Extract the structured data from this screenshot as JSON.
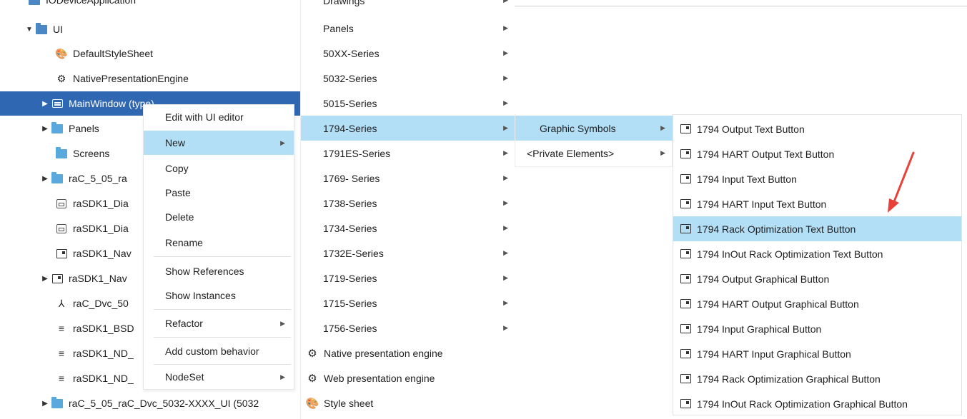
{
  "tree": {
    "partial_top": "IODeviceApplication",
    "items": [
      {
        "label": "UI",
        "arrow": "▼",
        "icon": "folder-dark-icon"
      },
      {
        "label": "DefaultStyleSheet",
        "arrow": "",
        "icon": "stylesheet-icon"
      },
      {
        "label": "NativePresentationEngine",
        "arrow": "",
        "icon": "gear-icon"
      },
      {
        "label": "MainWindow (type)",
        "arrow": "▶",
        "icon": "window-icon"
      },
      {
        "label": "Panels",
        "arrow": "▶",
        "icon": "folder-icon"
      },
      {
        "label": "Screens",
        "arrow": "",
        "icon": "folder-icon"
      },
      {
        "label": "raC_5_05_ra",
        "arrow": "▶",
        "icon": "folder-icon"
      },
      {
        "label": "raSDK1_Dia",
        "arrow": "",
        "icon": "dialog-icon"
      },
      {
        "label": "raSDK1_Dia",
        "arrow": "",
        "icon": "dialog-icon"
      },
      {
        "label": "raSDK1_Nav",
        "arrow": "",
        "icon": "button-icon"
      },
      {
        "label": "raSDK1_Nav",
        "arrow": "▶",
        "icon": "nav-button-icon"
      },
      {
        "label": "raC_Dvc_50",
        "arrow": "",
        "icon": "network-icon"
      },
      {
        "label": "raSDK1_BSD",
        "arrow": "",
        "icon": "struct-icon"
      },
      {
        "label": "raSDK1_ND_",
        "arrow": "",
        "icon": "struct-icon"
      },
      {
        "label": "raSDK1_ND_",
        "arrow": "",
        "icon": "struct-icon"
      },
      {
        "label": "raC_5_05_raC_Dvc_5032-XXXX_UI (5032",
        "arrow": "▶",
        "icon": "folder-icon"
      }
    ]
  },
  "context_menu": {
    "items": [
      {
        "label": "Edit with UI editor",
        "submenu": false
      },
      {
        "label": "New",
        "submenu": true,
        "highlighted": true
      },
      {
        "label": "Copy",
        "submenu": false
      },
      {
        "label": "Paste",
        "submenu": false
      },
      {
        "label": "Delete",
        "submenu": false
      },
      {
        "label": "Rename",
        "submenu": false
      },
      {
        "label": "Show References",
        "submenu": false
      },
      {
        "label": "Show Instances",
        "submenu": false
      },
      {
        "label": "Refactor",
        "submenu": true
      },
      {
        "label": "Add custom behavior",
        "submenu": false
      },
      {
        "label": "NodeSet",
        "submenu": true
      }
    ]
  },
  "series_menu": {
    "partial_top": "Drawings",
    "items": [
      {
        "label": "Panels"
      },
      {
        "label": "50XX-Series"
      },
      {
        "label": "5032-Series"
      },
      {
        "label": "5015-Series"
      },
      {
        "label": "1794-Series",
        "highlighted": true
      },
      {
        "label": "1791ES-Series"
      },
      {
        "label": "1769- Series"
      },
      {
        "label": "1738-Series"
      },
      {
        "label": "1734-Series"
      },
      {
        "label": "1732E-Series"
      },
      {
        "label": "1719-Series"
      },
      {
        "label": "1715-Series"
      },
      {
        "label": "1756-Series"
      }
    ],
    "engines": [
      {
        "label": "Native presentation engine",
        "icon": "gear-icon"
      },
      {
        "label": "Web presentation engine",
        "icon": "gear-icon"
      },
      {
        "label": "Style sheet",
        "icon": "stylesheet-icon"
      }
    ]
  },
  "graphic_menu": {
    "items": [
      {
        "label": "Graphic Symbols",
        "highlighted": true
      },
      {
        "label": "<Private Elements>"
      }
    ]
  },
  "buttons_menu": {
    "items": [
      {
        "label": "1794 Output Text Button"
      },
      {
        "label": "1794 HART Output Text Button"
      },
      {
        "label": "1794 Input Text Button"
      },
      {
        "label": "1794 HART Input Text Button"
      },
      {
        "label": "1794 Rack Optimization Text Button",
        "highlighted": true
      },
      {
        "label": "1794 InOut Rack Optimization Text Button"
      },
      {
        "label": "1794 Output Graphical Button"
      },
      {
        "label": "1794 HART Output Graphical Button"
      },
      {
        "label": "1794 Input Graphical Button"
      },
      {
        "label": "1794 HART Input Graphical Button"
      },
      {
        "label": "1794 Rack Optimization Graphical Button"
      },
      {
        "label": "1794 InOut Rack Optimization Graphical Button"
      }
    ]
  },
  "colors": {
    "selection": "#2f67b3",
    "hover": "#b3dff6",
    "annotation_arrow": "#e8413a"
  }
}
